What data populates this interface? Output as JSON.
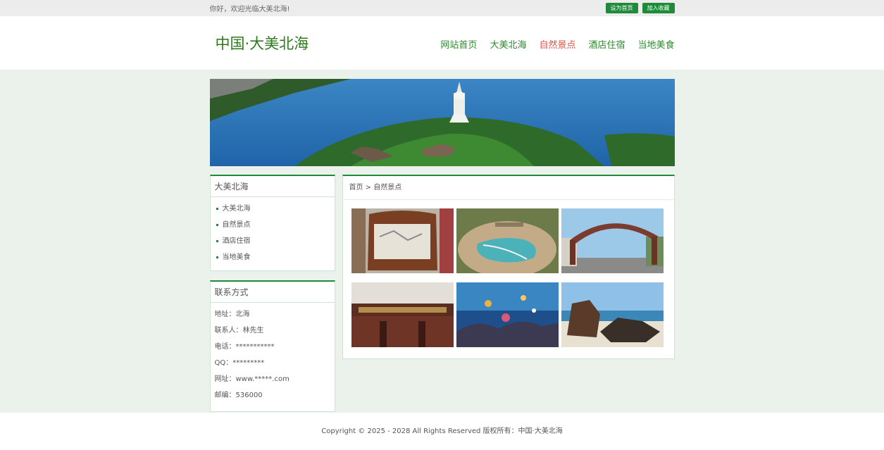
{
  "topbar": {
    "greeting": "你好，欢迎光临大美北海!",
    "set_home": "设为首页",
    "add_fav": "加入收藏"
  },
  "header": {
    "logo": "中国·大美北海",
    "nav": [
      "网站首页",
      "大美北海",
      "自然景点",
      "酒店住宿",
      "当地美食"
    ],
    "active_nav": "自然景点"
  },
  "sidebar": {
    "category_title": "大美北海",
    "items": [
      "大美北海",
      "自然景点",
      "酒店住宿",
      "当地美食"
    ],
    "contact_title": "联系方式",
    "contact": [
      "地址：北海",
      "联系人：林先生",
      "电话：***********",
      "QQ：*********",
      "网址：www.*****.com",
      "邮编：536000"
    ]
  },
  "content": {
    "breadcrumb": "首页 > 自然景点",
    "thumbs": [
      "wooden-sign-image",
      "map-stone-image",
      "gateway-arch-image",
      "museum-sign-image",
      "aquarium-image",
      "beach-rocks-image"
    ]
  },
  "footer": {
    "copyright": "Copyright © 2025 - 2028 All Rights Reserved 版权所有：中国·大美北海"
  },
  "colors": {
    "accent": "#1e8a3a",
    "nav_active": "#e0524a",
    "page_bg": "#ebf2ec"
  }
}
